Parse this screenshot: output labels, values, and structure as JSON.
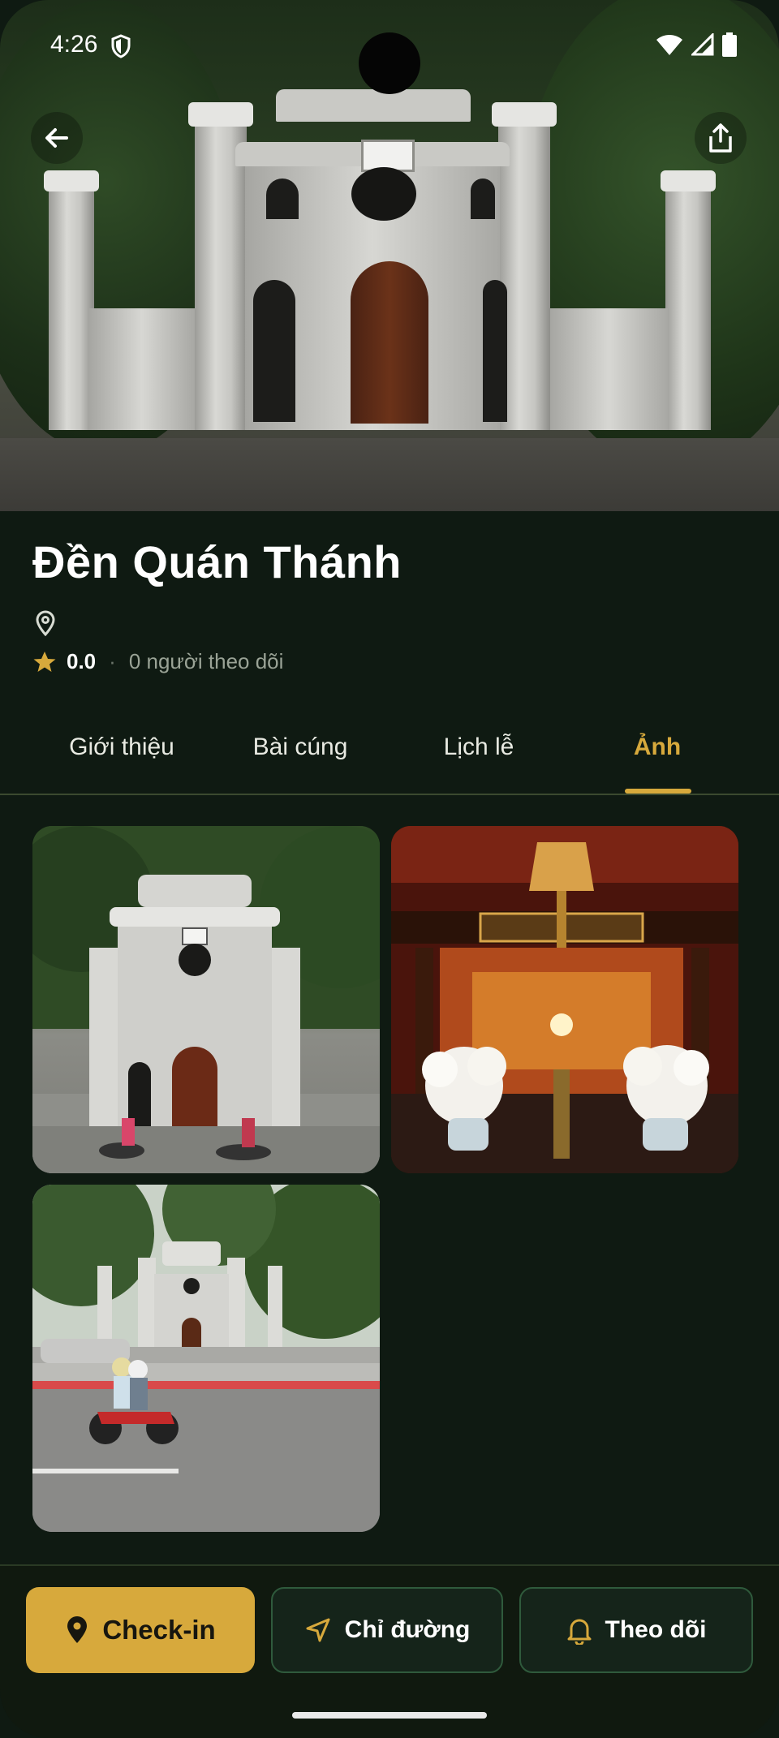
{
  "status_bar": {
    "time": "4:26"
  },
  "place": {
    "name": "Đền Quán Thánh",
    "rating": "0.0",
    "followers": "0 người theo dõi"
  },
  "tabs": [
    {
      "label": "Giới thiệu",
      "active": false
    },
    {
      "label": "Bài cúng",
      "active": false
    },
    {
      "label": "Lịch lễ",
      "active": false
    },
    {
      "label": "Ảnh",
      "active": true
    }
  ],
  "photos": [
    {
      "subject": "temple-gate-front"
    },
    {
      "subject": "temple-altar-interior"
    },
    {
      "subject": "temple-gate-street"
    }
  ],
  "actions": {
    "checkin": "Check-in",
    "directions": "Chỉ đường",
    "follow": "Theo dõi"
  },
  "colors": {
    "background": "#0f1a12",
    "accent": "#d7a93c",
    "button_border": "#2f5a3c"
  },
  "icons": [
    "back-arrow-icon",
    "share-icon",
    "location-pin-icon",
    "star-icon",
    "map-pin-filled-icon",
    "navigation-arrow-icon",
    "bell-icon"
  ]
}
